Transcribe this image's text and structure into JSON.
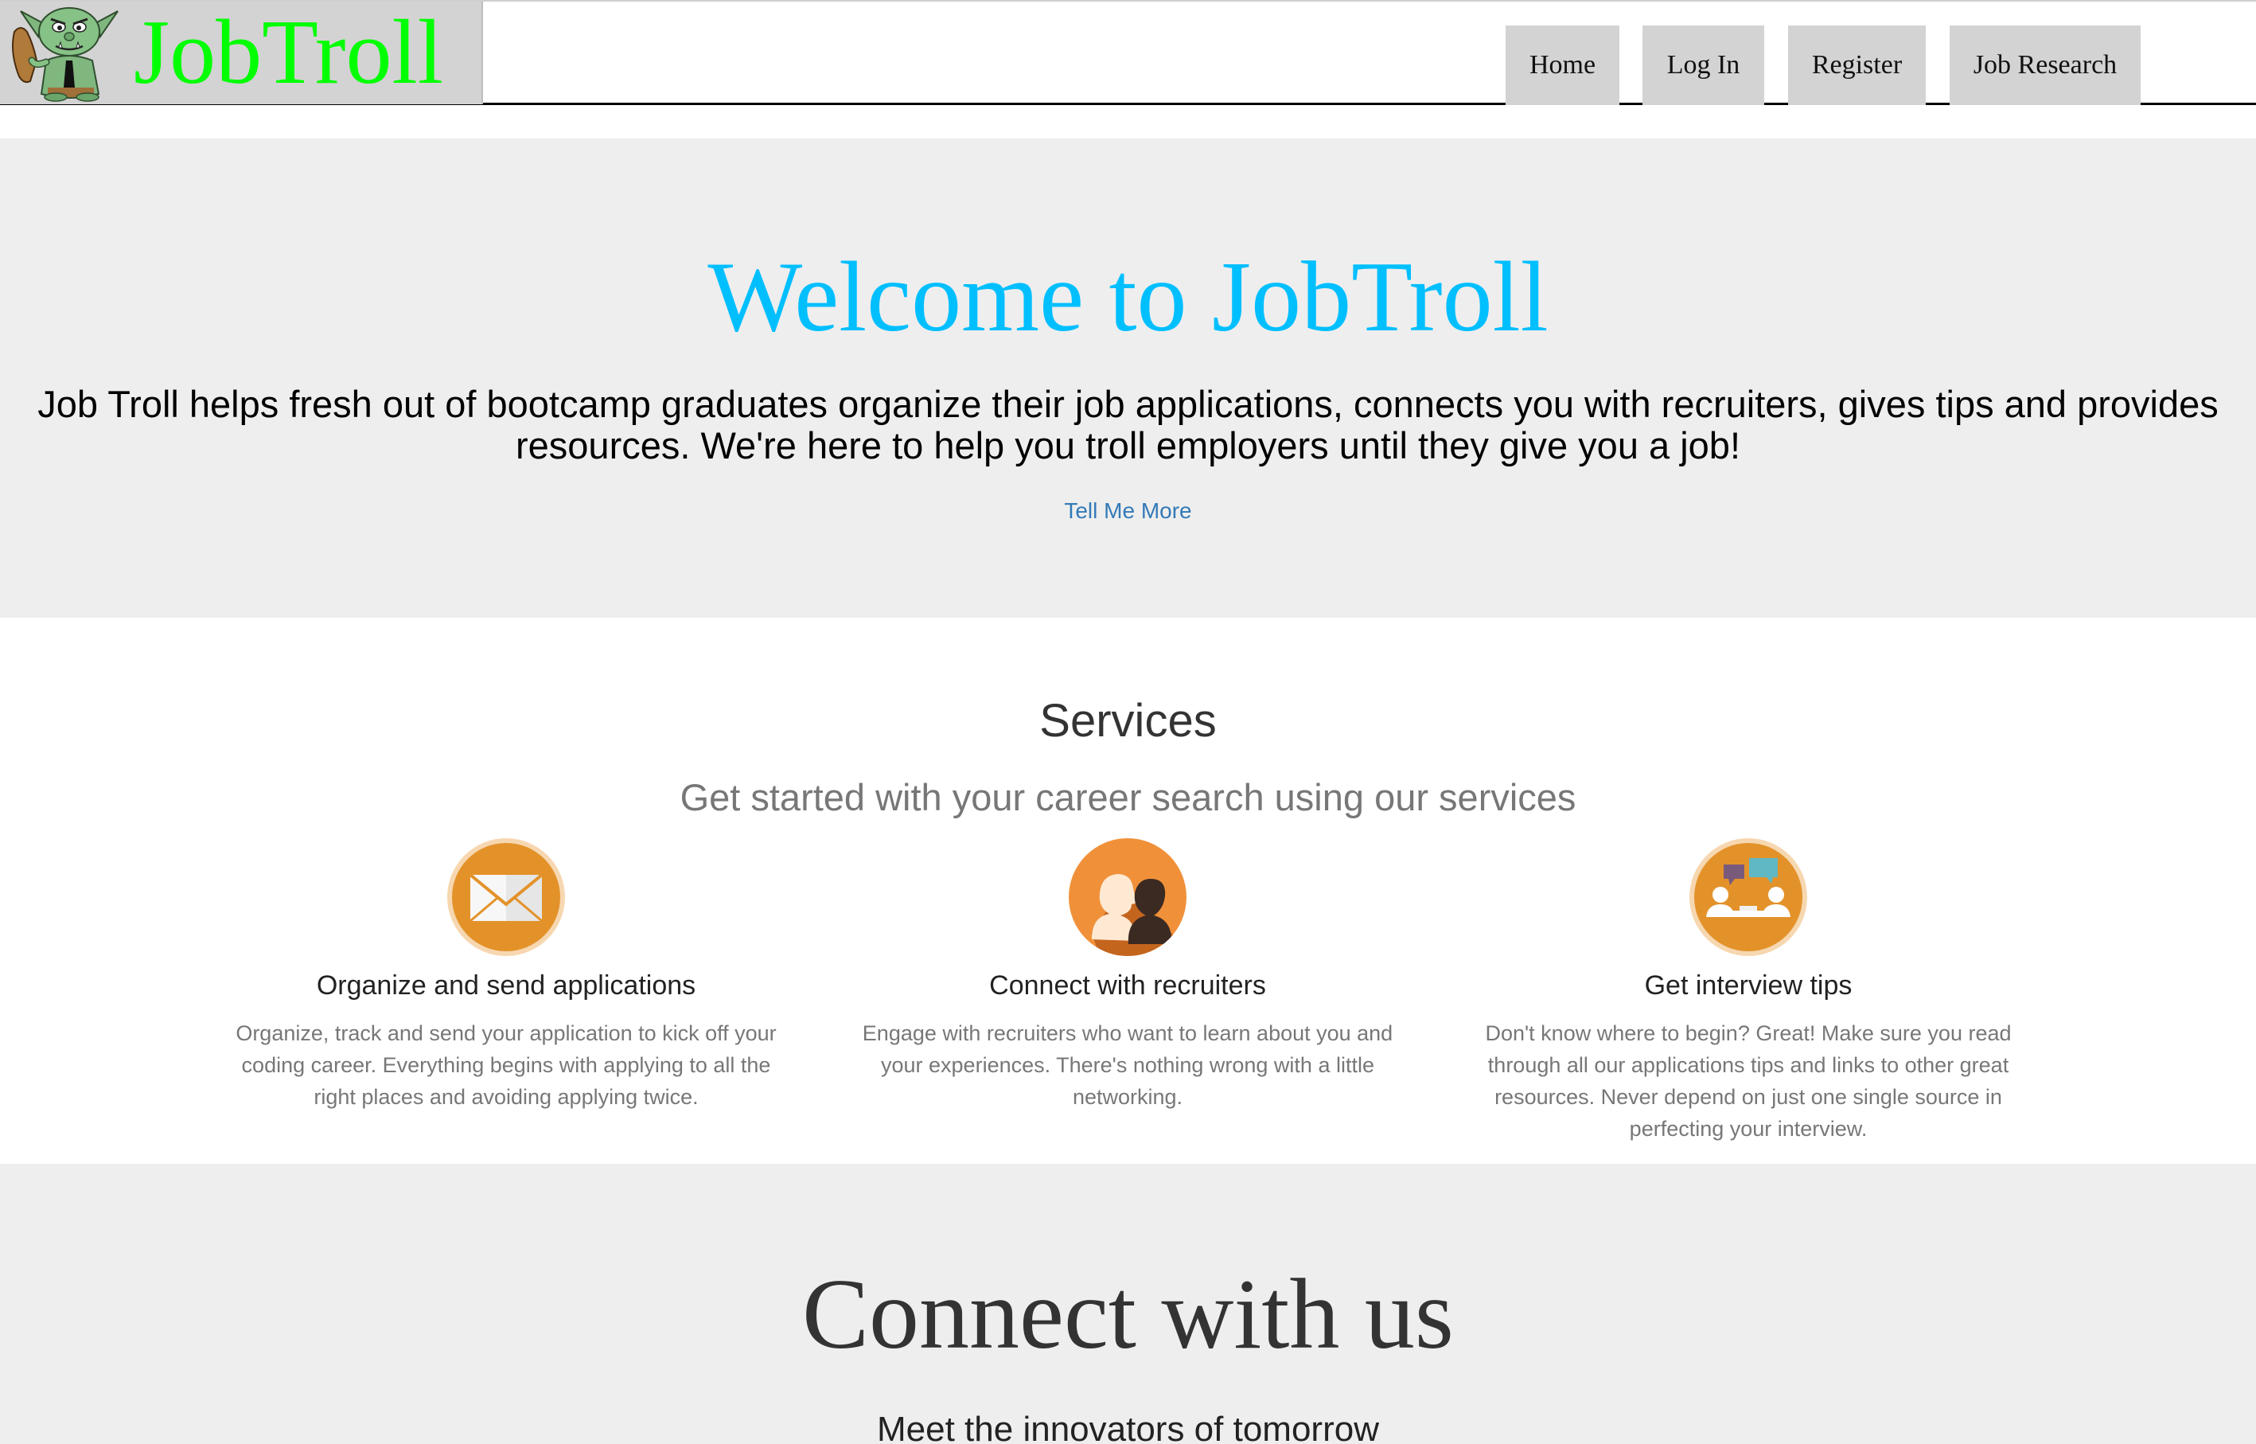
{
  "brand": {
    "name": "JobTroll",
    "name_color": "#00ff00",
    "logo_icon": "troll-mascot-icon"
  },
  "nav": {
    "items": [
      {
        "label": "Home"
      },
      {
        "label": "Log In"
      },
      {
        "label": "Register"
      },
      {
        "label": "Job Research"
      }
    ]
  },
  "hero": {
    "title": "Welcome to JobTroll",
    "title_color": "#00bfff",
    "lead_line1": "Job Troll helps fresh out of bootcamp graduates organize their job applications, connects you with recruiters, gives tips and provides",
    "lead_line2": "resources. We're here to help you troll employers until they give you a job!",
    "link_label": "Tell Me More",
    "link_color": "#337ab7"
  },
  "services": {
    "heading": "Services",
    "subheading": "Get started with your career search using our services",
    "accent_color": "#e3922a",
    "items": [
      {
        "icon": "envelope-icon",
        "title": "Organize and send applications",
        "text": "Organize, track and send your application to kick off your coding career. Everything begins with applying to all the right places and avoiding applying twice."
      },
      {
        "icon": "recruiters-icon",
        "title": "Connect with recruiters",
        "text": "Engage with recruiters who want to learn about you and your experiences. There's nothing wrong with a little networking."
      },
      {
        "icon": "interview-icon",
        "title": "Get interview tips",
        "text": "Don't know where to begin? Great! Make sure you read through all our applications tips and links to other great resources. Never depend on just one single source in perfecting your interview."
      }
    ]
  },
  "connect": {
    "title": "Connect with us",
    "subtitle": "Meet the innovators of tomorrow"
  }
}
